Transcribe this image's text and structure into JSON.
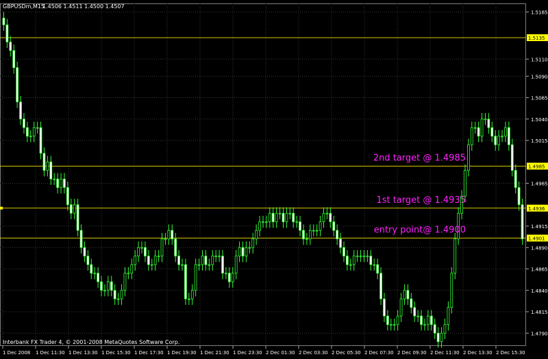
{
  "header": {
    "symbol": "GBPUSDm,M15",
    "ohlc": "1.4506 1.4511 1.4500 1.4507"
  },
  "footer": {
    "copyright": "Interbank FX Trader 4, © 2001-2008 MetaQuotes Software Corp."
  },
  "colors": {
    "background": "#000000",
    "grid": "#3a3a3a",
    "candle": "#33ff33",
    "hline": "#d4c800",
    "annotation": "#ff22ff",
    "axis_text": "#ffffff"
  },
  "chart_data": {
    "type": "candlestick",
    "y_ticks": [
      "1.5165",
      "1.5110",
      "1.5090",
      "1.5065",
      "1.5040",
      "1.5015",
      "1.4965",
      "1.4915",
      "1.4890",
      "1.4865",
      "1.4840",
      "1.4815",
      "1.4790"
    ],
    "x_ticks": [
      "1 Dec 2008",
      "1 Dec 11:30",
      "1 Dec 13:30",
      "1 Dec 15:30",
      "1 Dec 17:30",
      "1 Dec 19:30",
      "1 Dec 21:30",
      "1 Dec 23:30",
      "2 Dec 01:30",
      "2 Dec 03:30",
      "2 Dec 05:30",
      "2 Dec 07:30",
      "2 Dec 09:30",
      "2 Dec 11:30",
      "2 Dec 13:30",
      "2 Dec 15:30"
    ],
    "ylim": [
      1.4775,
      1.5175
    ],
    "price_levels": [
      {
        "value": 1.5135,
        "label": "1.5135",
        "annotation": ""
      },
      {
        "value": 1.4985,
        "label": "1.4985",
        "annotation": "2nd target @ 1.4985"
      },
      {
        "value": 1.4936,
        "label": "1.4936",
        "annotation": "1st target @ 1.4935"
      },
      {
        "value": 1.4901,
        "label": "1.4901",
        "annotation": "entry point@ 1.4900"
      }
    ],
    "closes": [
      1.515,
      1.513,
      1.512,
      1.51,
      1.506,
      1.504,
      1.503,
      1.502,
      1.502,
      1.503,
      1.503,
      1.5,
      1.498,
      1.499,
      1.497,
      1.497,
      1.496,
      1.497,
      1.496,
      1.494,
      1.493,
      1.494,
      1.491,
      1.489,
      1.488,
      1.487,
      1.486,
      1.486,
      1.485,
      1.484,
      1.484,
      1.485,
      1.484,
      1.483,
      1.483,
      1.484,
      1.486,
      1.486,
      1.487,
      1.488,
      1.489,
      1.489,
      1.488,
      1.487,
      1.487,
      1.488,
      1.488,
      1.49,
      1.49,
      1.491,
      1.49,
      1.488,
      1.487,
      1.487,
      1.483,
      1.483,
      1.484,
      1.487,
      1.487,
      1.488,
      1.487,
      1.487,
      1.488,
      1.488,
      1.488,
      1.486,
      1.486,
      1.485,
      1.486,
      1.488,
      1.489,
      1.488,
      1.489,
      1.489,
      1.49,
      1.491,
      1.492,
      1.492,
      1.492,
      1.493,
      1.492,
      1.493,
      1.493,
      1.492,
      1.493,
      1.493,
      1.492,
      1.492,
      1.491,
      1.49,
      1.49,
      1.491,
      1.491,
      1.491,
      1.492,
      1.493,
      1.493,
      1.492,
      1.491,
      1.49,
      1.489,
      1.488,
      1.487,
      1.487,
      1.488,
      1.488,
      1.488,
      1.488,
      1.488,
      1.487,
      1.487,
      1.486,
      1.483,
      1.481,
      1.48,
      1.48,
      1.48,
      1.481,
      1.483,
      1.484,
      1.483,
      1.482,
      1.481,
      1.481,
      1.48,
      1.48,
      1.481,
      1.48,
      1.479,
      1.478,
      1.479,
      1.48,
      1.482,
      1.486,
      1.49,
      1.493,
      1.495,
      1.498,
      1.501,
      1.503,
      1.503,
      1.502,
      1.504,
      1.504,
      1.503,
      1.502,
      1.501,
      1.502,
      1.502,
      1.503,
      1.501,
      1.498,
      1.496,
      1.494,
      1.49
    ]
  }
}
